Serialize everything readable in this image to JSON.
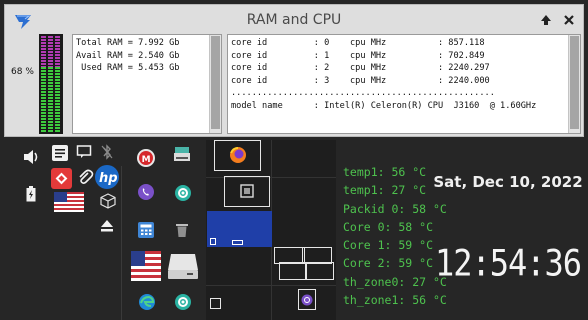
{
  "window": {
    "title": "RAM and CPU",
    "maximize_icon": "up-arrow-icon",
    "close_icon": "close-x-icon"
  },
  "ram": {
    "percent_label": "68 %",
    "used_fraction": 0.68,
    "lines": [
      "Total RAM = 7.992 Gb",
      "Avail RAM = 2.540 Gb",
      " Used RAM = 5.453 Gb"
    ]
  },
  "cpu": {
    "lines": [
      "core id         : 0    cpu MHz          : 857.118",
      "core id         : 1    cpu MHz          : 702.849",
      "core id         : 2    cpu MHz          : 2240.297",
      "core id         : 3    cpu MHz          : 2240.000",
      "...................................................",
      "model name      : Intel(R) Celeron(R) CPU  J3160  @ 1.60GHz"
    ]
  },
  "sensors": [
    "temp1: 56 °C",
    "temp1: 27 °C",
    "Packid 0: 58 °C",
    "Core 0: 58 °C",
    "Core 1: 59 °C",
    "Core 2: 59 °C",
    "th_zone0: 27 °C",
    "th_zone1: 56 °C"
  ],
  "date": "Sat, Dec 10, 2022",
  "time": "12:54:36",
  "colors": {
    "sensor_text": "#4ec24e",
    "ram_used": "#3ecc3e",
    "ram_free": "#b23ab3",
    "pager_active": "#1f3fa8"
  }
}
